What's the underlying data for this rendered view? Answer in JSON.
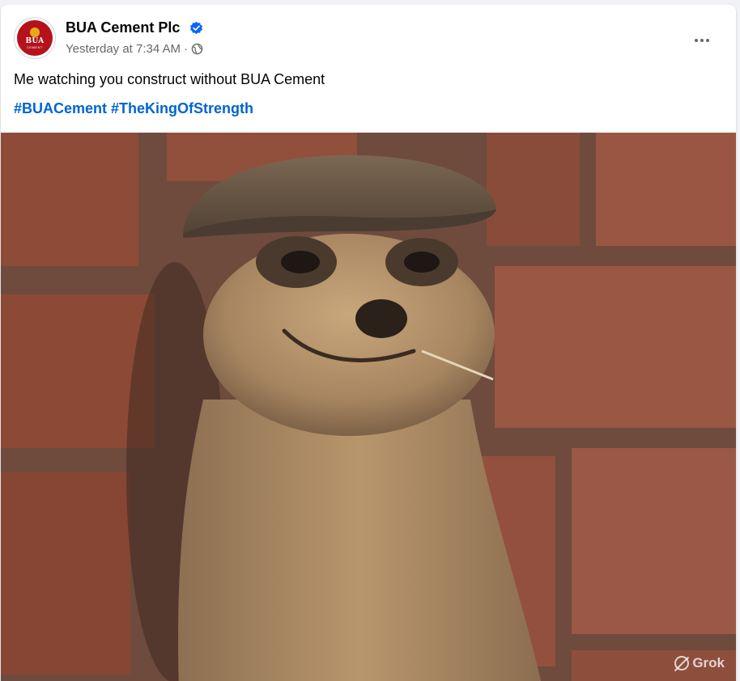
{
  "post": {
    "author": "BUA Cement Plc",
    "avatar_text": "BUA",
    "avatar_subtext": "CEMENT",
    "timestamp": "Yesterday at 7:34 AM",
    "separator": "·",
    "caption": "Me watching you construct without BUA Cement",
    "hashtags": [
      "#BUACement",
      "#TheKingOfStrength"
    ]
  },
  "photo": {
    "watermark": "Grok"
  },
  "icons": {
    "verified": "verified-badge-icon",
    "audience": "globe-icon",
    "more": "more-options-icon"
  },
  "colors": {
    "link": "#0064d1",
    "secondary_text": "#65676b",
    "verified": "#0866ff",
    "brand": "#b5121b"
  }
}
